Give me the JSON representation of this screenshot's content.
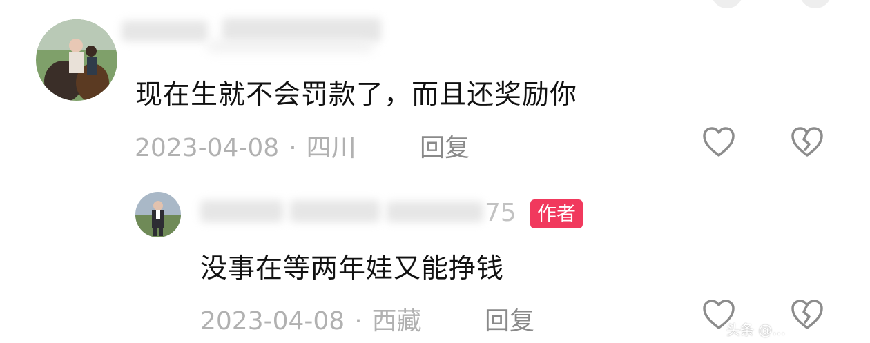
{
  "comments": [
    {
      "text": "现在生就不会罚款了，而且还奖励你",
      "date": "2023-04-08",
      "separator": "·",
      "location": "四川",
      "reply_label": "回复",
      "like_icon": "heart-outline-icon",
      "dislike_icon": "broken-heart-icon"
    },
    {
      "name_visible_tail": "75",
      "badge": "作者",
      "text": "没事在等两年娃又能挣钱",
      "date": "2023-04-08",
      "separator": "·",
      "location": "西藏",
      "reply_label": "回复",
      "like_icon": "heart-outline-icon",
      "dislike_icon": "broken-heart-icon"
    }
  ],
  "watermark": "头条 @...",
  "colors": {
    "text": "#111111",
    "meta": "#b1b1b1",
    "reply": "#8a8a8a",
    "badge": "#f1395d",
    "icon": "#8c8c8c"
  }
}
